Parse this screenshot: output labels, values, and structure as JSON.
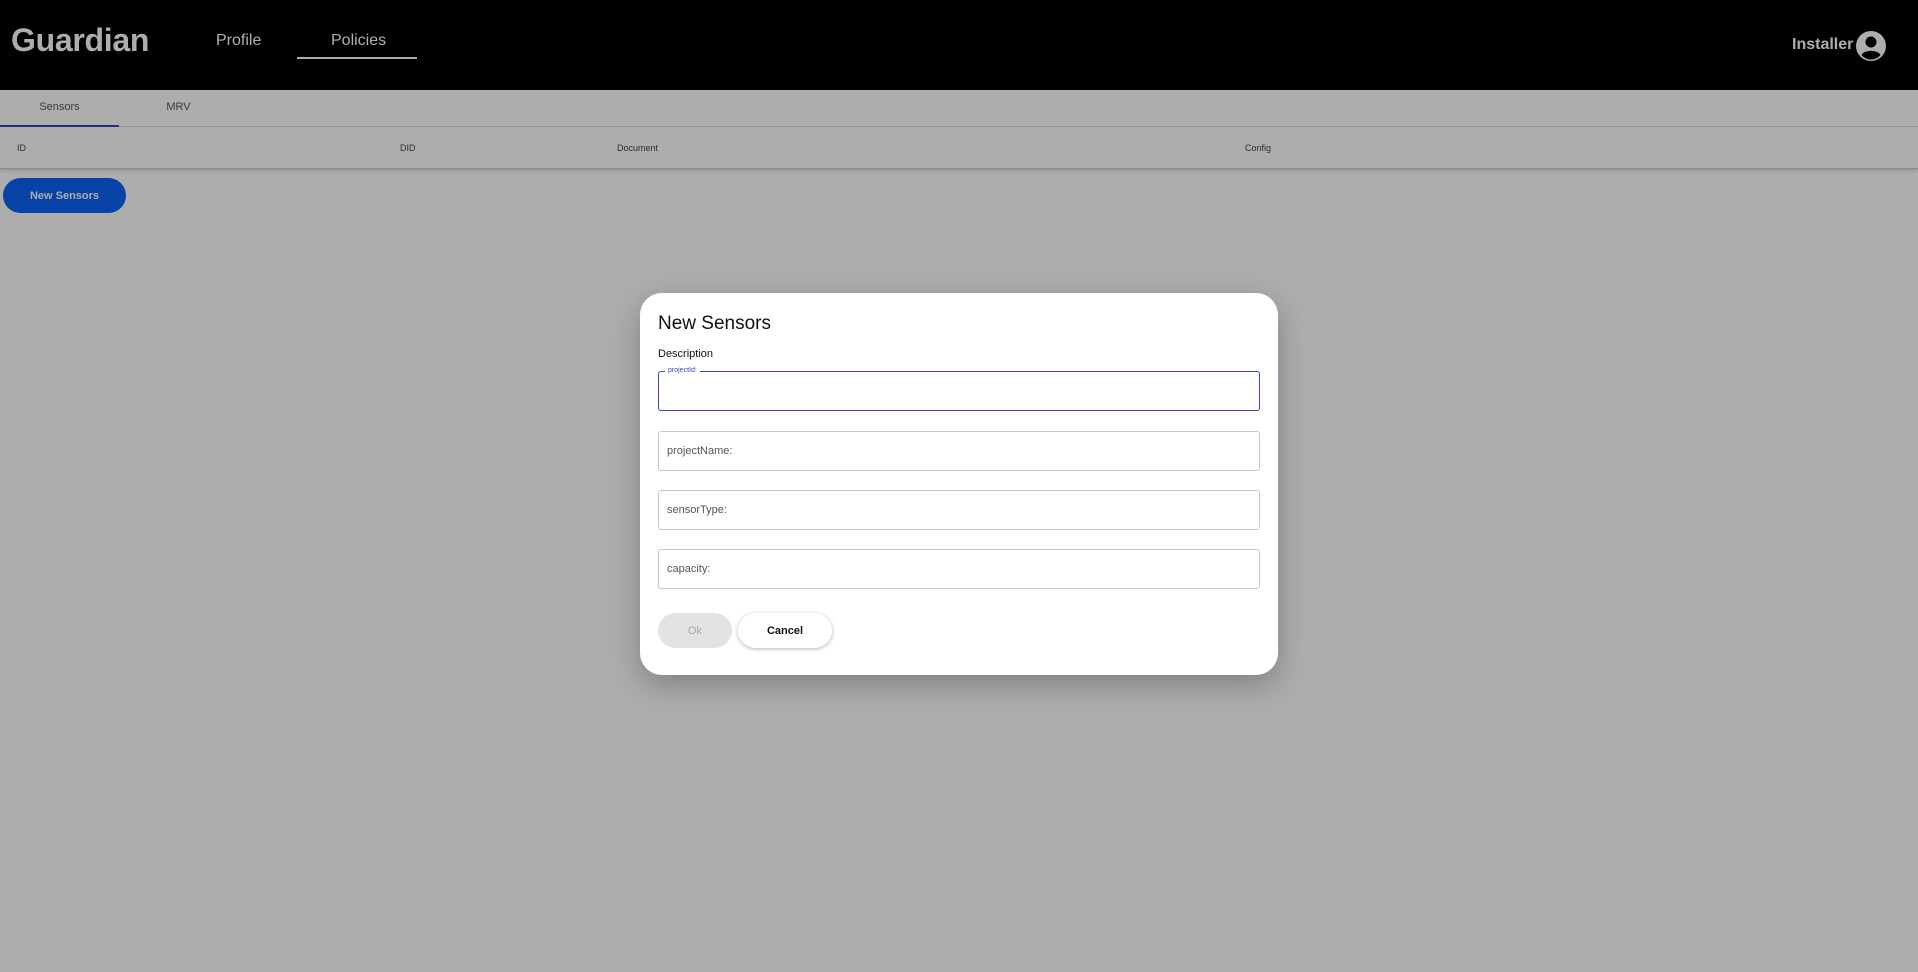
{
  "header": {
    "logo": "Guardian",
    "nav": {
      "profile": "Profile",
      "policies": "Policies"
    },
    "user_name": "Installer",
    "avatar_icon": "account-circle-icon"
  },
  "tabs": {
    "sensors": "Sensors",
    "mrv": "MRV"
  },
  "table": {
    "columns": {
      "id": "ID",
      "did": "DID",
      "document": "Document",
      "config": "Config"
    }
  },
  "new_sensors_button": "New Sensors",
  "dialog": {
    "title": "New Sensors",
    "description": "Description",
    "fields": {
      "project_id": {
        "label": "projectId:",
        "value": ""
      },
      "project_name": {
        "placeholder": "projectName:",
        "value": ""
      },
      "sensor_type": {
        "placeholder": "sensorType:",
        "value": ""
      },
      "capacity": {
        "placeholder": "capacity:",
        "value": ""
      }
    },
    "ok_label": "Ok",
    "cancel_label": "Cancel"
  },
  "colors": {
    "primary": "#0b63f6",
    "focus": "#3a47b4",
    "header_bg": "#000000"
  }
}
